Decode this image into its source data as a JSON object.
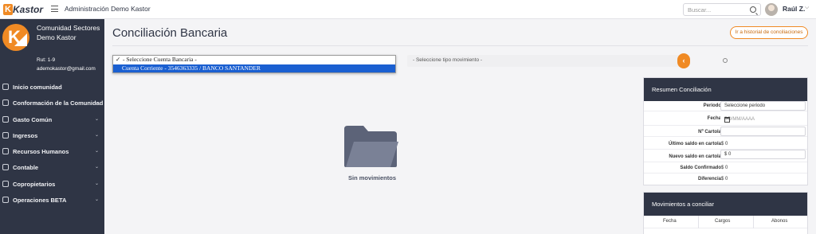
{
  "topbar": {
    "logo_text": "Kastor",
    "logo_letter": "K",
    "title": "Administración Demo Kastor",
    "search_placeholder": "Buscar...",
    "user_name": "Raúl Z.",
    "user_chevron": "⌵"
  },
  "sidebar": {
    "org_name": "Comunidad Sectores Demo Kastor",
    "rut": "Rut: 1-9",
    "email": "ademokastor@gmail.com",
    "items": [
      {
        "label": "Inicio comunidad",
        "chevron": ""
      },
      {
        "label": "Conformación de la Comunidad",
        "chevron": "⌄"
      },
      {
        "label": "Gasto Común",
        "chevron": "⌄"
      },
      {
        "label": "Ingresos",
        "chevron": "⌄"
      },
      {
        "label": "Recursos Humanos",
        "chevron": "⌄"
      },
      {
        "label": "Contable",
        "chevron": "⌄"
      },
      {
        "label": "Copropietarios",
        "chevron": "⌄"
      },
      {
        "label": "Operaciones BETA",
        "chevron": "⌄"
      }
    ]
  },
  "main": {
    "title": "Conciliación Bancaria",
    "history_button": "Ir a historial de conciliaciones",
    "account_select": {
      "options": [
        {
          "label": "- Seleccione Cuenta Bancaria -",
          "checked": "✓"
        },
        {
          "label": "Cuenta Corriente - 3546363335 / BANCO SANTANDER",
          "checked": ""
        }
      ]
    },
    "tipo_placeholder": "- Seleccione tipo movimiento -",
    "tipo_button": "‹",
    "empty_text": "Sin movimientos"
  },
  "resumen": {
    "title": "Resumen Conciliación",
    "rows": [
      {
        "label": "Periodo",
        "value": "Seleccione periodo"
      },
      {
        "label": "Fecha",
        "value": "DD/MM/AAAA"
      },
      {
        "label": "Nº Cartola",
        "value": ""
      },
      {
        "label": "Último saldo en cartola",
        "value": "$ 0"
      },
      {
        "label": "Nuevo saldo en cartola",
        "value": "$ 0"
      },
      {
        "label": "Saldo Confirmado",
        "value": "$ 0"
      },
      {
        "label": "Diferencia",
        "value": "$ 0"
      }
    ]
  },
  "movimientos": {
    "title": "Movimientos a conciliar",
    "columns": [
      "Fecha",
      "Cargos",
      "Abonos"
    ]
  },
  "colors": {
    "accent": "#f08a24",
    "sidebar": "#2f3545",
    "select_highlight": "#1a5fd1"
  }
}
